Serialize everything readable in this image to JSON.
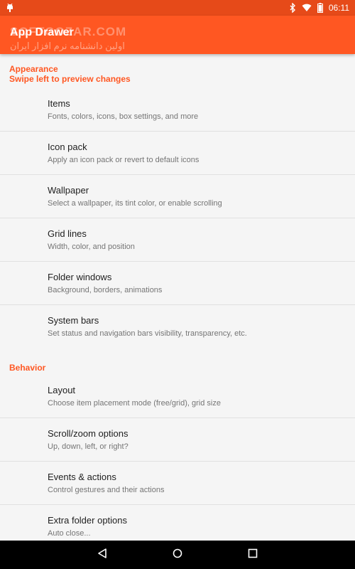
{
  "status_bar": {
    "time": "06:11",
    "icons": [
      "android-debug-icon",
      "bluetooth-icon",
      "wifi-icon",
      "battery-icon"
    ]
  },
  "app_bar": {
    "title": "App Drawer",
    "watermark": "SOFTGOZAR.COM",
    "watermark_sub": "اولین دانشنامه نرم افزار ایران"
  },
  "sections": {
    "appearance": {
      "header_line1": "Appearance",
      "header_line2": "Swipe left to preview changes",
      "items": [
        {
          "title": "Items",
          "summary": "Fonts, colors, icons, box settings, and more"
        },
        {
          "title": "Icon pack",
          "summary": "Apply an icon pack or revert to default icons"
        },
        {
          "title": "Wallpaper",
          "summary": "Select a wallpaper, its tint color, or enable scrolling"
        },
        {
          "title": "Grid lines",
          "summary": "Width, color, and position"
        },
        {
          "title": "Folder windows",
          "summary": "Background, borders, animations"
        },
        {
          "title": "System bars",
          "summary": "Set status and navigation bars visibility, transparency, etc."
        }
      ]
    },
    "behavior": {
      "header": "Behavior",
      "items": [
        {
          "title": "Layout",
          "summary": "Choose item placement mode (free/grid), grid size"
        },
        {
          "title": "Scroll/zoom options",
          "summary": "Up, down, left, or right?"
        },
        {
          "title": "Events & actions",
          "summary": "Control gestures and their actions"
        },
        {
          "title": "Extra folder options",
          "summary": "Auto close..."
        }
      ]
    }
  },
  "nav_bar": {
    "buttons": [
      "back-icon",
      "home-icon",
      "recents-icon"
    ]
  },
  "colors": {
    "accent": "#ff5722",
    "status_bar": "#e64a19",
    "nav_bar": "#000000"
  }
}
